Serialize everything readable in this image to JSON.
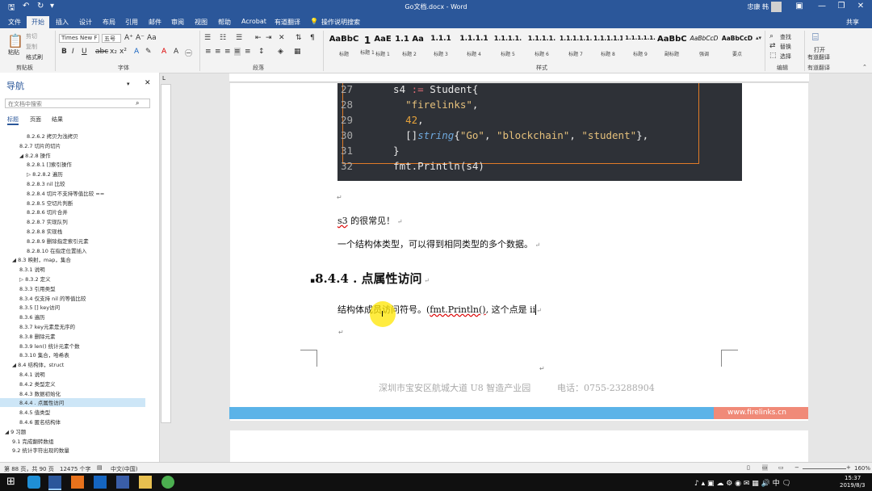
{
  "window": {
    "title": "Go文档.docx - Word",
    "user": "忠康 韩"
  },
  "tabs": [
    "文件",
    "开始",
    "插入",
    "设计",
    "布局",
    "引用",
    "邮件",
    "审阅",
    "视图",
    "帮助",
    "Acrobat",
    "有道翻译"
  ],
  "tell_me": "操作说明搜索",
  "share": "共享",
  "ribbon": {
    "clipboard": {
      "paste": "粘贴",
      "cut": "剪切",
      "copy": "复制",
      "format_painter": "格式刷",
      "label": "剪贴板"
    },
    "font": {
      "name": "Times New F",
      "size": "五号",
      "label": "字体"
    },
    "paragraph": {
      "label": "段落"
    },
    "styles": {
      "label": "样式",
      "items": [
        {
          "preview": "AaBbC",
          "name": "标题"
        },
        {
          "preview": "1",
          "name": "标题 1"
        },
        {
          "preview": "AaE",
          "name": "标题 1"
        },
        {
          "preview": "1.1 Aa",
          "name": "标题 2"
        },
        {
          "preview": "1.1.1",
          "name": "标题 3"
        },
        {
          "preview": "1.1.1.1",
          "name": "标题 4"
        },
        {
          "preview": "1.1.1.1.",
          "name": "标题 5"
        },
        {
          "preview": "1.1.1.1.",
          "name": "标题 6"
        },
        {
          "preview": "1.1.1.1.1.",
          "name": "标题 7"
        },
        {
          "preview": "1.1.1.1.1",
          "name": "标题 8"
        },
        {
          "preview": "1.1.1.1.1.",
          "name": "标题 9"
        },
        {
          "preview": "AaBbC",
          "name": "副标题"
        },
        {
          "preview": "AaBbCcD",
          "name": "强调"
        },
        {
          "preview": "AaBbCcD",
          "name": "要点"
        }
      ]
    },
    "editing": {
      "find": "查找",
      "replace": "替换",
      "select": "选择",
      "label": "编辑"
    },
    "youdao": {
      "open": "打开",
      "translate": "有道翻译",
      "label": "有道翻译"
    }
  },
  "nav": {
    "title": "导航",
    "search_placeholder": "在文档中搜索",
    "tabs": [
      "标题",
      "页面",
      "结果"
    ],
    "items": [
      {
        "text": "8.2.6.2 拷贝为浅拷贝",
        "indent": 4
      },
      {
        "text": "8.2.7 切片的切片",
        "indent": 3
      },
      {
        "text": "◢ 8.2.8 操作",
        "indent": 3
      },
      {
        "text": "8.2.8.1 []索引操作",
        "indent": 4
      },
      {
        "text": "▷ 8.2.8.2 遍历",
        "indent": 4
      },
      {
        "text": "8.2.8.3 nil 比较",
        "indent": 4
      },
      {
        "text": "8.2.8.4 切片不支持等值比较 ==",
        "indent": 4
      },
      {
        "text": "8.2.8.5 空切片判断",
        "indent": 4
      },
      {
        "text": "8.2.8.6 切片合并",
        "indent": 4
      },
      {
        "text": "8.2.8.7 实现队列",
        "indent": 4
      },
      {
        "text": "8.2.8.8 实现栈",
        "indent": 4
      },
      {
        "text": "8.2.8.9 删除指定索引元素",
        "indent": 4
      },
      {
        "text": "8.2.8.10 在指定位置插入",
        "indent": 4
      },
      {
        "text": "◢ 8.3 映射，map，集合",
        "indent": 2
      },
      {
        "text": "8.3.1 说明",
        "indent": 3
      },
      {
        "text": "▷ 8.3.2 定义",
        "indent": 3
      },
      {
        "text": "8.3.3 引用类型",
        "indent": 3
      },
      {
        "text": "8.3.4 仅支持 nil 的等值比较",
        "indent": 3
      },
      {
        "text": "8.3.5 [] key访问",
        "indent": 3
      },
      {
        "text": "8.3.6 遍历",
        "indent": 3
      },
      {
        "text": "8.3.7 key元素是无序的",
        "indent": 3
      },
      {
        "text": "8.3.8 删除元素",
        "indent": 3
      },
      {
        "text": "8.3.9 len() 统计元素个数",
        "indent": 3
      },
      {
        "text": "8.3.10 集合，哈希表",
        "indent": 3
      },
      {
        "text": "◢ 8.4 结构体，struct",
        "indent": 2
      },
      {
        "text": "8.4.1 说明",
        "indent": 3
      },
      {
        "text": "8.4.2 类型定义",
        "indent": 3
      },
      {
        "text": "8.4.3 数据初始化",
        "indent": 3
      },
      {
        "text": "8.4.4 . 点属性访问",
        "indent": 3,
        "selected": true
      },
      {
        "text": "8.4.5 值类型",
        "indent": 3
      },
      {
        "text": "8.4.6 匿名结构体",
        "indent": 3
      },
      {
        "text": "◢ 9 习题",
        "indent": 1
      },
      {
        "text": "9.1 完成翻转数组",
        "indent": 2
      },
      {
        "text": "9.2 统计字符出现的数量",
        "indent": 2
      }
    ]
  },
  "code_lines": [
    {
      "n": "27",
      "code": "  s4 := Student{"
    },
    {
      "n": "28",
      "code": "    \"firelinks\","
    },
    {
      "n": "29",
      "code": "    42,"
    },
    {
      "n": "30",
      "code": "    []string{\"Go\", \"blockchain\", \"student\"},"
    },
    {
      "n": "31",
      "code": "  }"
    },
    {
      "n": "32",
      "code": "  fmt.Println(s4)"
    }
  ],
  "doc": {
    "p1_a": "s3",
    "p1_b": " 的很常见！",
    "p2": "一个结构体类型，可以得到相同类型的多个数据。",
    "heading": "8.4.4 . 点属性访问",
    "p3_a": "结构体成员访问符号。(",
    "p3_b": "fmt.Println()",
    "p3_c": ", 这个点是 ii",
    "footer_address": "深圳市宝安区航城大道 U8 智造产业园",
    "footer_phone": "电话：0755-23288904",
    "footer_url": "www.firelinks.cn"
  },
  "status": {
    "page": "第 88 页，共 90 页",
    "words": "12475 个字",
    "language": "中文(中国)",
    "zoom": "160%"
  },
  "clock": {
    "time": "15:37",
    "date": "2019/8/3"
  }
}
